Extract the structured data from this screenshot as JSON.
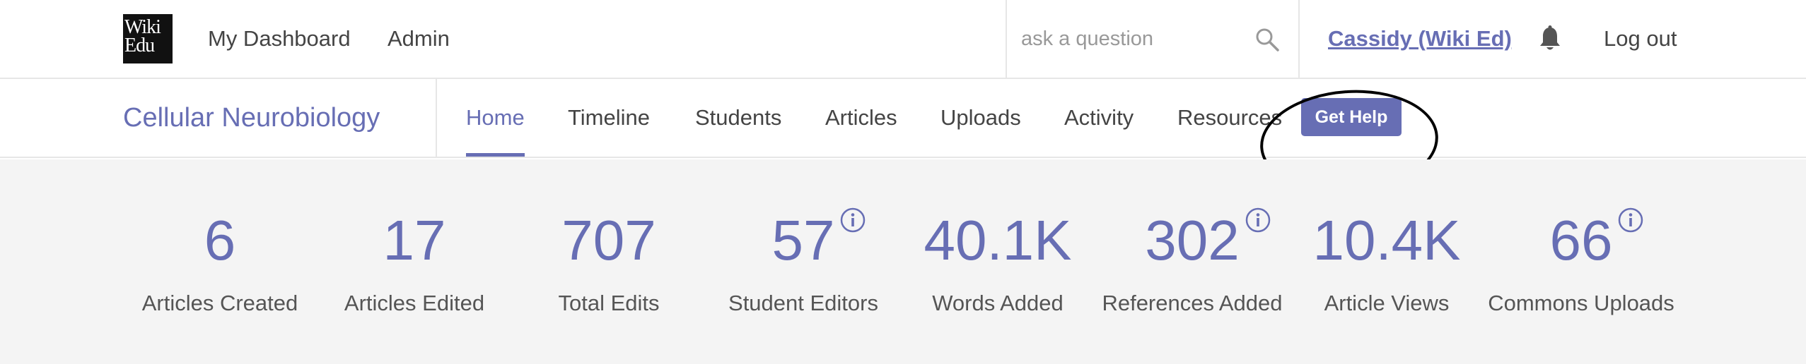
{
  "header": {
    "logo_lines": [
      "Wiki",
      "Edu"
    ],
    "nav": {
      "dashboard": "My Dashboard",
      "admin": "Admin"
    },
    "search": {
      "placeholder": "ask a question",
      "value": ""
    },
    "user": "Cassidy (Wiki Ed)",
    "logout": "Log out"
  },
  "course": {
    "title": "Cellular Neurobiology",
    "tabs": [
      {
        "label": "Home",
        "active": true
      },
      {
        "label": "Timeline",
        "active": false
      },
      {
        "label": "Students",
        "active": false
      },
      {
        "label": "Articles",
        "active": false
      },
      {
        "label": "Uploads",
        "active": false
      },
      {
        "label": "Activity",
        "active": false
      },
      {
        "label": "Resources",
        "active": false
      }
    ],
    "help_button": "Get Help"
  },
  "stats": [
    {
      "value": "6",
      "label": "Articles Created",
      "info": false
    },
    {
      "value": "17",
      "label": "Articles Edited",
      "info": false
    },
    {
      "value": "707",
      "label": "Total Edits",
      "info": false
    },
    {
      "value": "57",
      "label": "Student Editors",
      "info": true
    },
    {
      "value": "40.1K",
      "label": "Words Added",
      "info": false
    },
    {
      "value": "302",
      "label": "References Added",
      "info": true
    },
    {
      "value": "10.4K",
      "label": "Article Views",
      "info": false
    },
    {
      "value": "66",
      "label": "Commons Uploads",
      "info": true
    }
  ],
  "colors": {
    "accent": "#676eb4",
    "stats_background": "#f4f4f4",
    "annotation": "#000000"
  },
  "icons": {
    "search": "search-icon",
    "notifications": "bell-icon",
    "info": "info-icon"
  }
}
